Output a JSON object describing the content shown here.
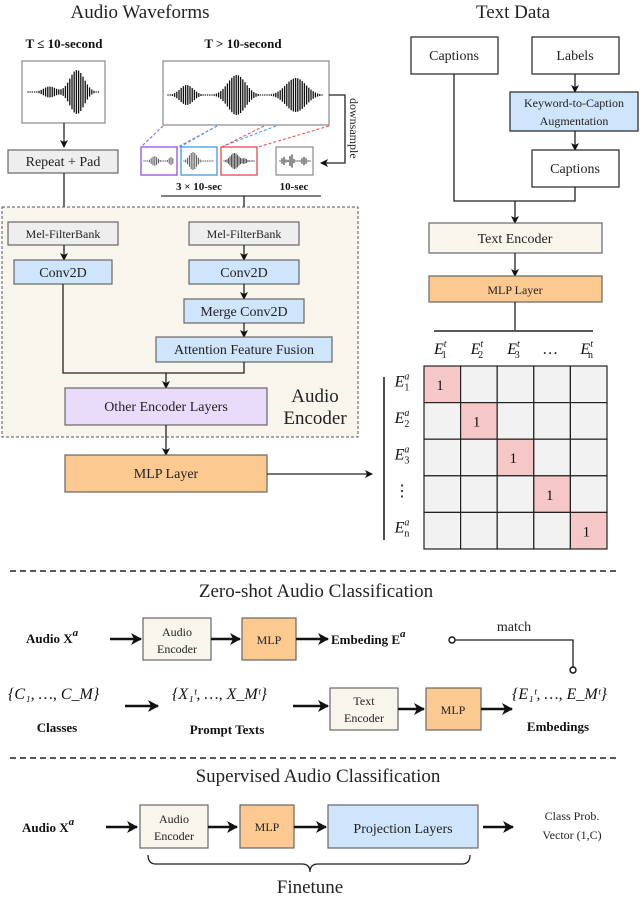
{
  "audio": {
    "title": "Audio Waveforms",
    "short_label": "T ≤ 10-second",
    "long_label": "T > 10-second",
    "repeat_pad": "Repeat + Pad",
    "downsample": "downsample",
    "chunks_label": "3 × 10-sec",
    "ten_sec_label": "10-sec",
    "mel_left": "Mel-FilterBank",
    "mel_right": "Mel-FilterBank",
    "conv_left": "Conv2D",
    "conv_right": "Conv2D",
    "merge_conv": "Merge Conv2D",
    "aff": "Attention Feature Fusion",
    "other_layers": "Other Encoder Layers",
    "encoder_label_1": "Audio",
    "encoder_label_2": "Encoder",
    "mlp": "MLP Layer",
    "chunk_colors": [
      "#a259e6",
      "#4aa3e8",
      "#e85555"
    ]
  },
  "text": {
    "title": "Text Data",
    "captions": "Captions",
    "labels": "Labels",
    "k2c_1": "Keyword-to-Caption",
    "k2c_2": "Augmentation",
    "captions2": "Captions",
    "encoder": "Text Encoder",
    "mlp": "MLP Layer"
  },
  "matrix": {
    "col_headers": [
      "E",
      "E",
      "E",
      "…",
      "E"
    ],
    "col_subs": [
      "1",
      "2",
      "3",
      "",
      "n"
    ],
    "col_sup": "t",
    "row_headers": [
      "E",
      "E",
      "E",
      "⋮",
      "E"
    ],
    "row_subs": [
      "1",
      "2",
      "3",
      "",
      "n"
    ],
    "row_sup": "a",
    "diag_value": "1",
    "size": 5
  },
  "zeroshot": {
    "title": "Zero-shot Audio Classification",
    "audio_in": "Audio X",
    "audio_in_sup": "a",
    "audio_encoder_1": "Audio",
    "audio_encoder_2": "Encoder",
    "mlp1": "MLP",
    "embedding": "Embeding E",
    "embedding_sup": "a",
    "match": "match",
    "classes_set": "{C₁, …, C_M}",
    "classes_label": "Classes",
    "prompt_set": "{X₁ᵗ, …, X_Mᵗ}",
    "prompt_label": "Prompt Texts",
    "text_encoder_1": "Text",
    "text_encoder_2": "Encoder",
    "mlp2": "MLP",
    "emb_set": "{E₁ᵗ, …, E_Mᵗ}",
    "emb_label": "Embedings"
  },
  "supervised": {
    "title": "Supervised Audio Classification",
    "audio_in": "Audio X",
    "audio_in_sup": "a",
    "audio_encoder_1": "Audio",
    "audio_encoder_2": "Encoder",
    "mlp": "MLP",
    "projection": "Projection Layers",
    "output_1": "Class Prob.",
    "output_2": "Vector (1,C)",
    "finetune": "Finetune"
  },
  "colors": {
    "gray_box": "#eeeeee",
    "blue_box": "#cfe5fb",
    "purple_box": "#e8dcfa",
    "orange_box": "#fcc991",
    "cream_box": "#f7f5ec",
    "encoder_bg": "#f8f6ec",
    "matrix_cell": "#f2f2f2",
    "matrix_diag": "#f6c7c7"
  }
}
